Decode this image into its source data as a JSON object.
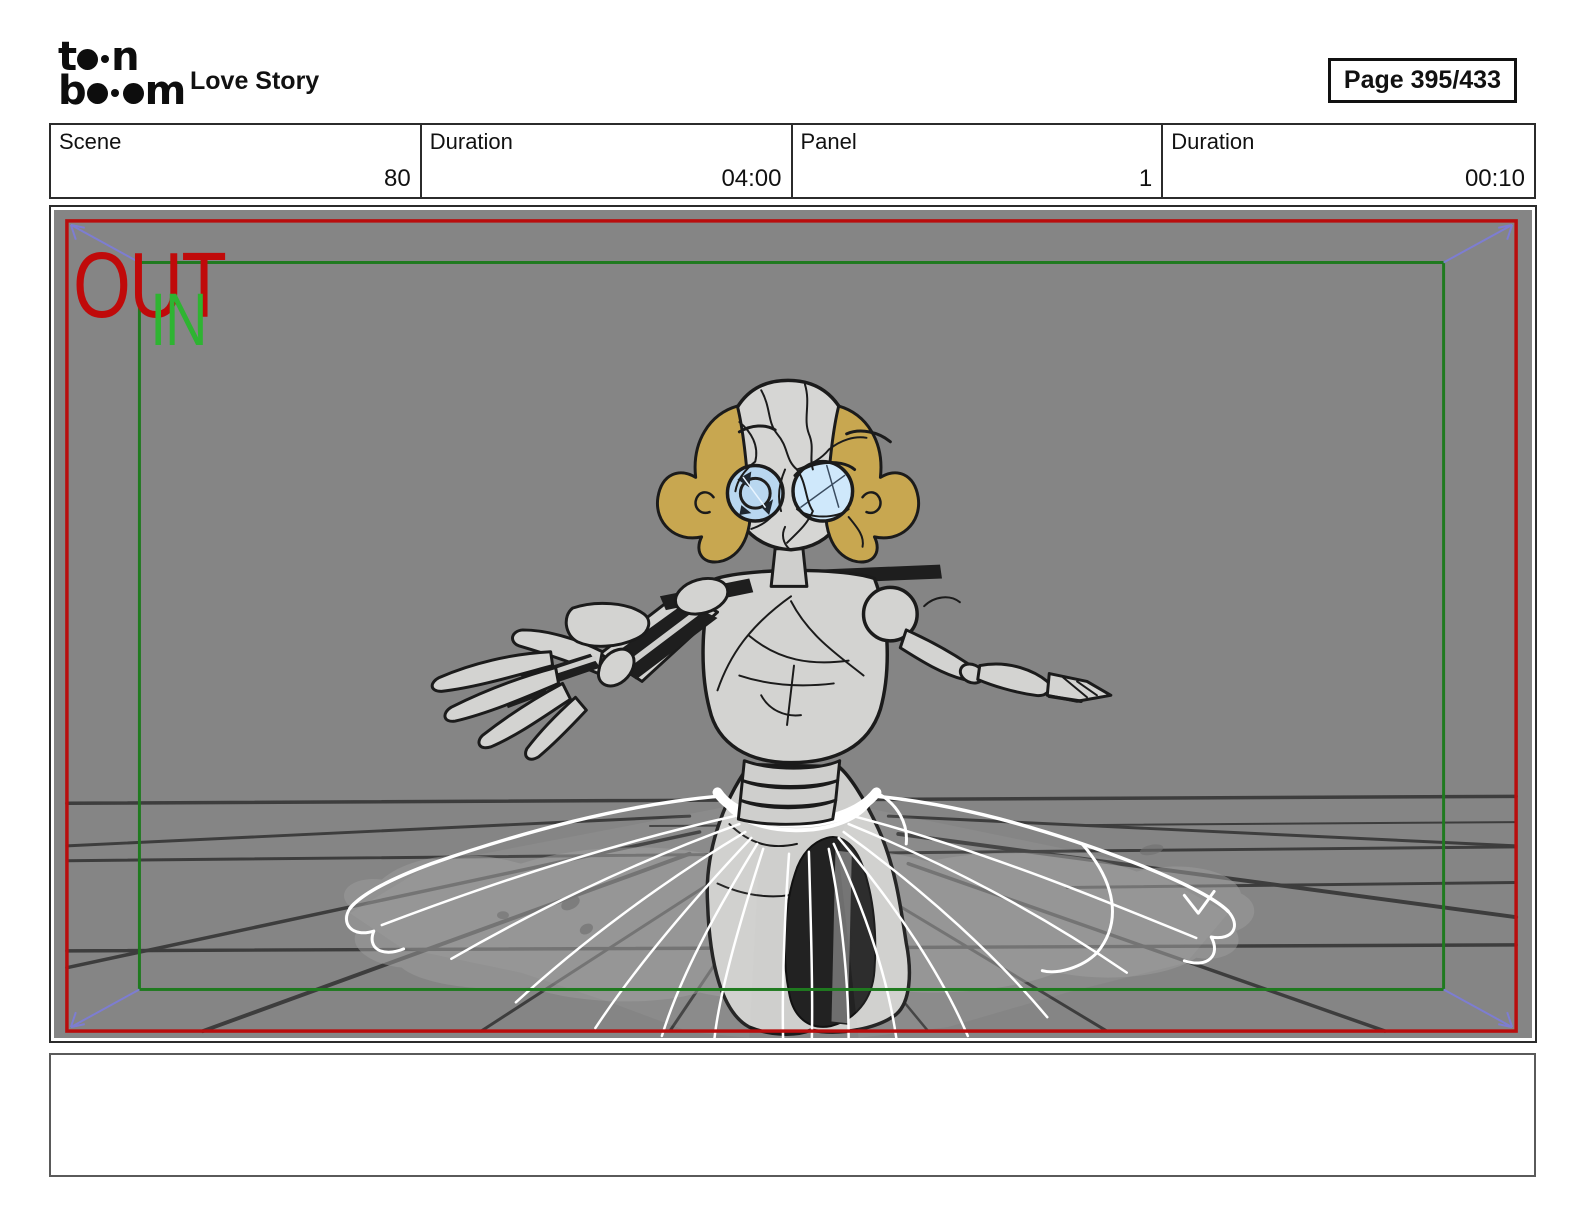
{
  "header": {
    "logo": {
      "line1_letter1": "t",
      "line1_letter2": "n",
      "line2_letter1": "b",
      "line2_letter2": "m"
    },
    "title": "Love Story",
    "page_label": "Page 395/433"
  },
  "info_table": {
    "cells": [
      {
        "label": "Scene",
        "value": "80"
      },
      {
        "label": "Duration",
        "value": "04:00"
      },
      {
        "label": "Panel",
        "value": "1"
      },
      {
        "label": "Duration",
        "value": "00:10"
      }
    ]
  },
  "panel": {
    "out_label": "OUT",
    "in_label": "IN",
    "colors": {
      "canvas_gray": "#858585",
      "camera_out_frame_red": "#b90d0d",
      "camera_in_frame_green": "#1f7a1f",
      "out_text_red": "#c00a0a",
      "in_text_green": "#2eb432",
      "motion_arrow_violet": "#7d7dd2",
      "figure_body_gray": "#d3d3d1",
      "hair_gold": "#c8a750",
      "eye_blue": "#cfe8fb",
      "outline_black": "#1b1b1b",
      "tutu_white": "#ffffff",
      "floor_line_gray": "#3d3d3d"
    }
  },
  "caption": {
    "text": ""
  }
}
